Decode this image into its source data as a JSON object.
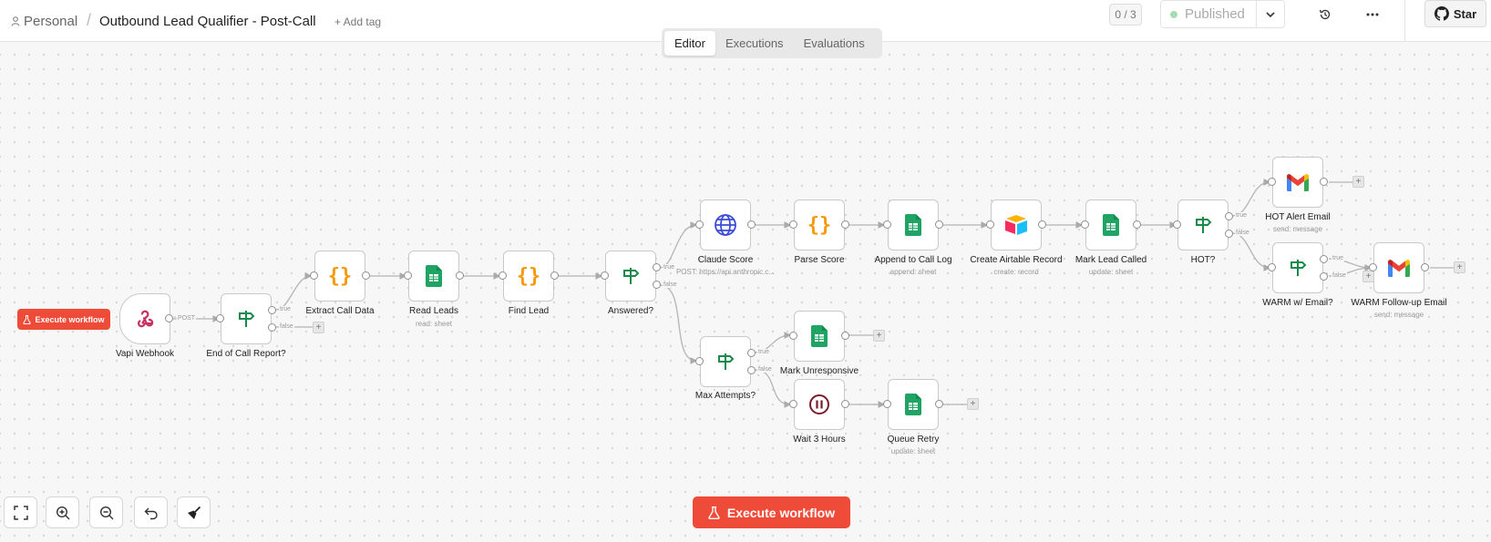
{
  "breadcrumb": {
    "project": "Personal",
    "separator": "/",
    "title": "Outbound Lead Qualifier - Post-Call",
    "add_tag": "+ Add tag"
  },
  "header": {
    "counter": "0 / 3",
    "published": "Published",
    "star": "Star"
  },
  "tabs": [
    {
      "label": "Editor",
      "active": true
    },
    {
      "label": "Executions",
      "active": false
    },
    {
      "label": "Evaluations",
      "active": false
    }
  ],
  "nodes": {
    "vapi_webhook": {
      "label": "Vapi Webhook",
      "icon": "webhook-icon"
    },
    "end_of_call": {
      "label": "End of Call Report?",
      "icon": "if-signpost-icon"
    },
    "extract_call_data": {
      "label": "Extract Call Data",
      "icon": "code-braces-icon"
    },
    "read_leads": {
      "label": "Read Leads",
      "sub": "read: sheet",
      "icon": "google-sheets-icon"
    },
    "find_lead": {
      "label": "Find Lead",
      "icon": "code-braces-icon"
    },
    "answered": {
      "label": "Answered?",
      "icon": "if-signpost-icon"
    },
    "claude_score": {
      "label": "Claude Score",
      "sub": "POST: https://api.anthropic.c...",
      "icon": "globe-icon"
    },
    "parse_score": {
      "label": "Parse Score",
      "icon": "code-braces-icon"
    },
    "append_call_log": {
      "label": "Append to Call Log",
      "sub": "append: sheet",
      "icon": "google-sheets-icon"
    },
    "create_airtable": {
      "label": "Create Airtable Record",
      "sub": "create: record",
      "icon": "airtable-icon"
    },
    "mark_lead_called": {
      "label": "Mark Lead Called",
      "sub": "update: sheet",
      "icon": "google-sheets-icon"
    },
    "hot": {
      "label": "HOT?",
      "icon": "if-signpost-icon"
    },
    "hot_alert": {
      "label": "HOT Alert Email",
      "sub": "send: message",
      "icon": "gmail-icon"
    },
    "warm_email": {
      "label": "WARM w/ Email?",
      "icon": "if-signpost-icon"
    },
    "warm_followup": {
      "label": "WARM Follow-up Email",
      "sub": "send: message",
      "icon": "gmail-icon"
    },
    "max_attempts": {
      "label": "Max Attempts?",
      "icon": "if-signpost-icon"
    },
    "mark_unresponsive": {
      "label": "Mark Unresponsive",
      "icon": "google-sheets-icon"
    },
    "wait_3_hours": {
      "label": "Wait 3 Hours",
      "icon": "pause-icon"
    },
    "queue_retry": {
      "label": "Queue Retry",
      "sub": "update: sheet",
      "icon": "google-sheets-icon"
    }
  },
  "edge_labels": {
    "post": "POST",
    "true_label": "true",
    "false_label": "false"
  },
  "plus_sign": "+",
  "buttons": {
    "execute_small": "Execute workflow",
    "execute_big": "Execute workflow"
  },
  "colors": {
    "accent": "#ef4b39",
    "sheets_green": "#1fa463",
    "code_orange": "#f59a0d",
    "if_green": "#1a8a4a",
    "globe_blue": "#3b4bd8",
    "webhook_pink": "#c7305f",
    "wait_maroon": "#7a1c2c"
  }
}
